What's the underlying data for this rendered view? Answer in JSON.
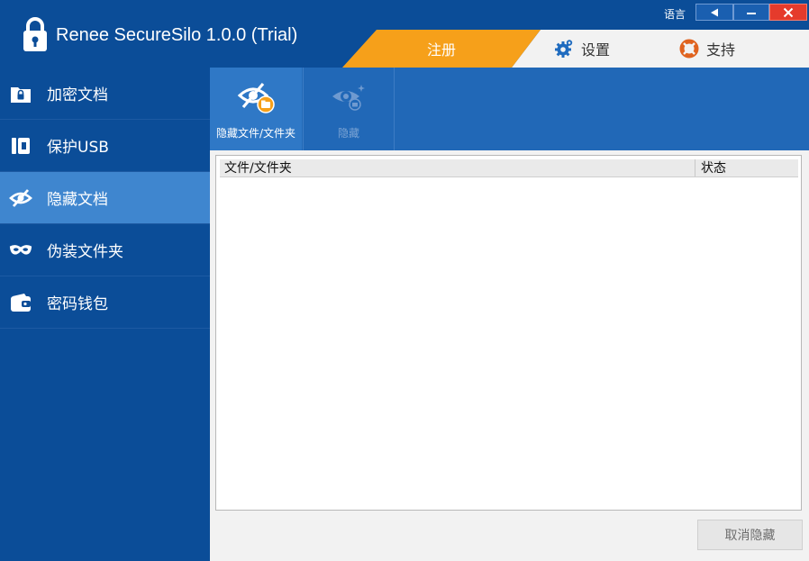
{
  "app": {
    "title": "Renee SecureSilo 1.0.0 (Trial)",
    "icon": "lock-icon"
  },
  "window_controls": {
    "language_label": "语言",
    "language_icon": "triangle-left-icon",
    "minimize_icon": "minimize-icon",
    "close_icon": "close-icon"
  },
  "tabs": {
    "register": "注册",
    "settings": "设置",
    "support": "支持"
  },
  "sidebar": {
    "items": [
      {
        "label": "加密文档",
        "icon": "lock-folder-icon",
        "active": false
      },
      {
        "label": "保护USB",
        "icon": "usb-drive-icon",
        "active": false
      },
      {
        "label": "隐藏文档",
        "icon": "eye-slash-icon",
        "active": true
      },
      {
        "label": "伪装文件夹",
        "icon": "mask-icon",
        "active": false
      },
      {
        "label": "密码钱包",
        "icon": "wallet-icon",
        "active": false
      }
    ]
  },
  "toolbar": {
    "hide_files_label": "隐藏文件/文件夹",
    "hide_label": "隐藏"
  },
  "file_list": {
    "columns": [
      "文件/文件夹",
      "状态"
    ],
    "rows": []
  },
  "footer": {
    "cancel_hide_label": "取消隐藏"
  },
  "colors": {
    "sidebar_bg": "#0b4d98",
    "active_item": "#3f86cf",
    "toolbar_bg": "#2168b7",
    "register_tab": "#f6a01a",
    "close_button": "#e53b2c"
  }
}
